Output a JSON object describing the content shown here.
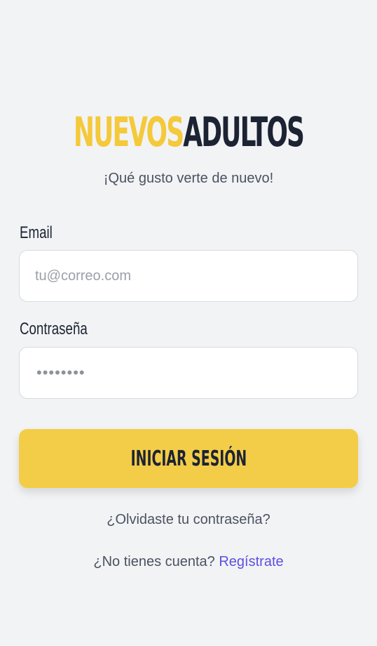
{
  "brand": {
    "logo_part_1": "NUEVOS",
    "logo_part_2": "ADULTOS",
    "color_primary": "#f4c93a",
    "color_dark": "#1c2333"
  },
  "tagline": "¡Qué gusto verte de nuevo!",
  "form": {
    "email_label": "Email",
    "email_placeholder": "tu@correo.com",
    "email_value": "",
    "password_label": "Contraseña",
    "password_masked": "••••••••",
    "submit_label": "INICIAR SESIÓN"
  },
  "links": {
    "forgot_password": "¿Olvidaste tu contraseña?",
    "no_account_text": "¿No tienes cuenta?",
    "register_label": "Regístrate",
    "link_color": "#5c4fe3"
  }
}
